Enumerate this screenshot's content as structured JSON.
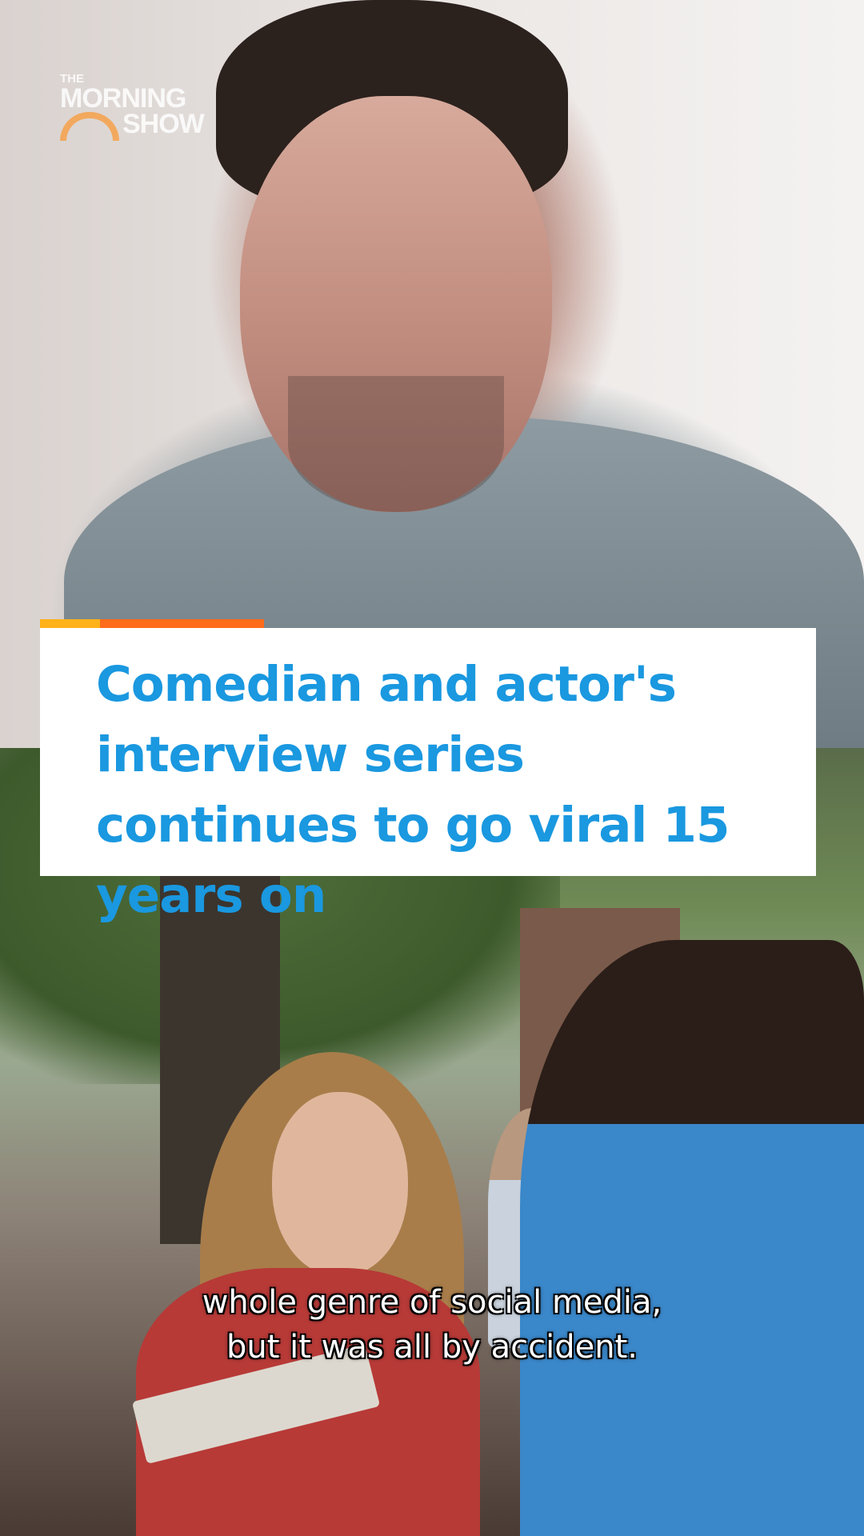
{
  "logo": {
    "line1": "THE",
    "line2": "MORNING",
    "line3": "SHOW"
  },
  "headline": {
    "text": "Comedian and actor's interview series continues to go viral 15 years on"
  },
  "caption": {
    "line1": "whole genre of social media,",
    "line2": "but it was all by accident."
  },
  "colors": {
    "headline_text": "#1a98e0",
    "accent_yellow": "#ffb21a",
    "accent_orange": "#ff6b1a",
    "headline_background": "#ffffff"
  }
}
